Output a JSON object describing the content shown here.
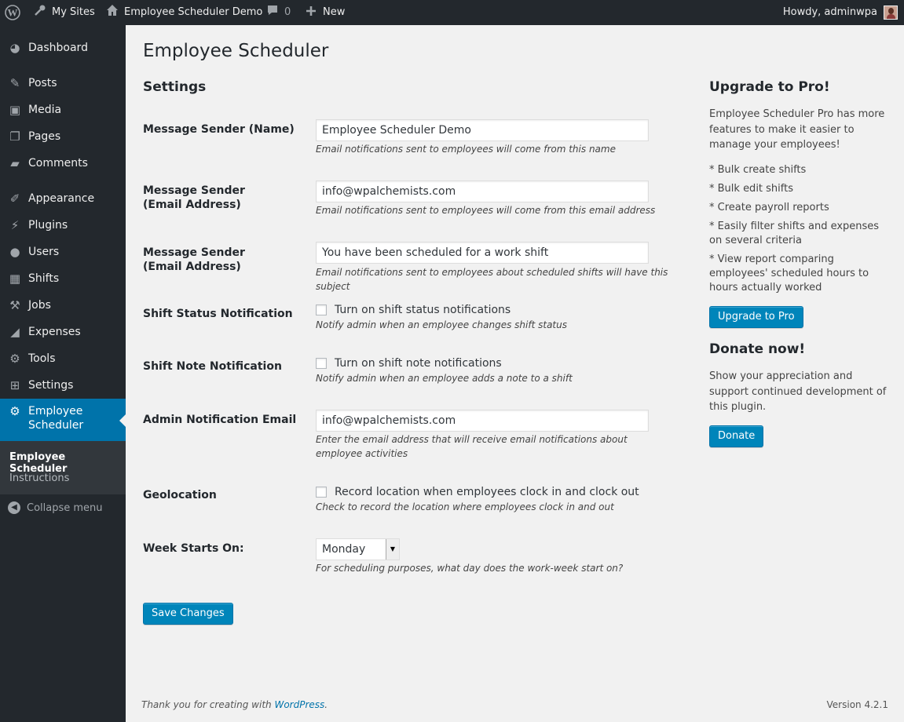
{
  "admin_bar": {
    "my_sites": "My Sites",
    "site_name": "Employee Scheduler Demo",
    "comments_count": "0",
    "new_label": "New",
    "howdy": "Howdy, adminwpa"
  },
  "sidebar": {
    "items": [
      {
        "label": "Dashboard",
        "icon": "dashboard-icon"
      },
      {
        "label": "Posts",
        "icon": "pin-icon"
      },
      {
        "label": "Media",
        "icon": "media-icon"
      },
      {
        "label": "Pages",
        "icon": "pages-icon"
      },
      {
        "label": "Comments",
        "icon": "comments-icon"
      },
      {
        "label": "Appearance",
        "icon": "brush-icon"
      },
      {
        "label": "Plugins",
        "icon": "plug-icon"
      },
      {
        "label": "Users",
        "icon": "user-icon"
      },
      {
        "label": "Shifts",
        "icon": "calendar-icon"
      },
      {
        "label": "Jobs",
        "icon": "hammer-icon"
      },
      {
        "label": "Expenses",
        "icon": "chart-icon"
      },
      {
        "label": "Tools",
        "icon": "wrench-icon"
      },
      {
        "label": "Settings",
        "icon": "settings-icon"
      }
    ],
    "current_line1": "Employee",
    "current_line2": "Scheduler",
    "submenu": [
      "Employee Scheduler",
      "Instructions"
    ],
    "collapse": "Collapse menu"
  },
  "main": {
    "title": "Employee Scheduler",
    "section": "Settings",
    "fields": {
      "sender_name": {
        "label": "Message Sender (Name)",
        "value": "Employee Scheduler Demo",
        "desc": "Email notifications sent to employees will come from this name"
      },
      "sender_email": {
        "label": "Message Sender (Email Address)",
        "value": "info@wpalchemists.com",
        "desc": "Email notifications sent to employees will come from this email address"
      },
      "subject": {
        "label": "Message Sender (Email Address)",
        "value": "You have been scheduled for a work shift",
        "desc": "Email notifications sent to employees about scheduled shifts will have this subject"
      },
      "shift_status": {
        "label": "Shift Status Notification",
        "checkbox": "Turn on shift status notifications",
        "desc": "Notify admin when an employee changes shift status"
      },
      "shift_note": {
        "label": "Shift Note Notification",
        "checkbox": "Turn on shift note notifications",
        "desc": "Notify admin when an employee adds a note to a shift"
      },
      "admin_email": {
        "label": "Admin Notification Email",
        "value": "info@wpalchemists.com",
        "desc": "Enter the email address that will receive email notifications about employee activities"
      },
      "geolocation": {
        "label": "Geolocation",
        "checkbox": "Record location when employees clock in and clock out",
        "desc": "Check to record the location where employees clock in and out"
      },
      "week_start": {
        "label": "Week Starts On:",
        "value": "Monday",
        "desc": "For scheduling purposes, what day does the work-week start on?"
      }
    },
    "save_button": "Save Changes"
  },
  "side": {
    "upgrade_title": "Upgrade to Pro!",
    "upgrade_text": "Employee Scheduler Pro has more features to make it easier to manage your employees!",
    "features": [
      "* Bulk create shifts",
      "* Bulk edit shifts",
      "* Create payroll reports",
      "* Easily filter shifts and expenses on several criteria",
      "* View report comparing employees' scheduled hours to hours actually worked"
    ],
    "upgrade_button": "Upgrade to Pro",
    "donate_title": "Donate now!",
    "donate_text": "Show your appreciation and support continued development of this plugin.",
    "donate_button": "Donate"
  },
  "footer": {
    "thanks_prefix": "Thank you for creating with",
    "wp_link": "WordPress",
    "thanks_suffix": ".",
    "version": "Version 4.2.1"
  },
  "colors": {
    "admin_bar": "#23282d",
    "sidebar": "#23282d",
    "accent": "#0073aa",
    "button": "#0085ba",
    "background": "#f1f1f1"
  }
}
